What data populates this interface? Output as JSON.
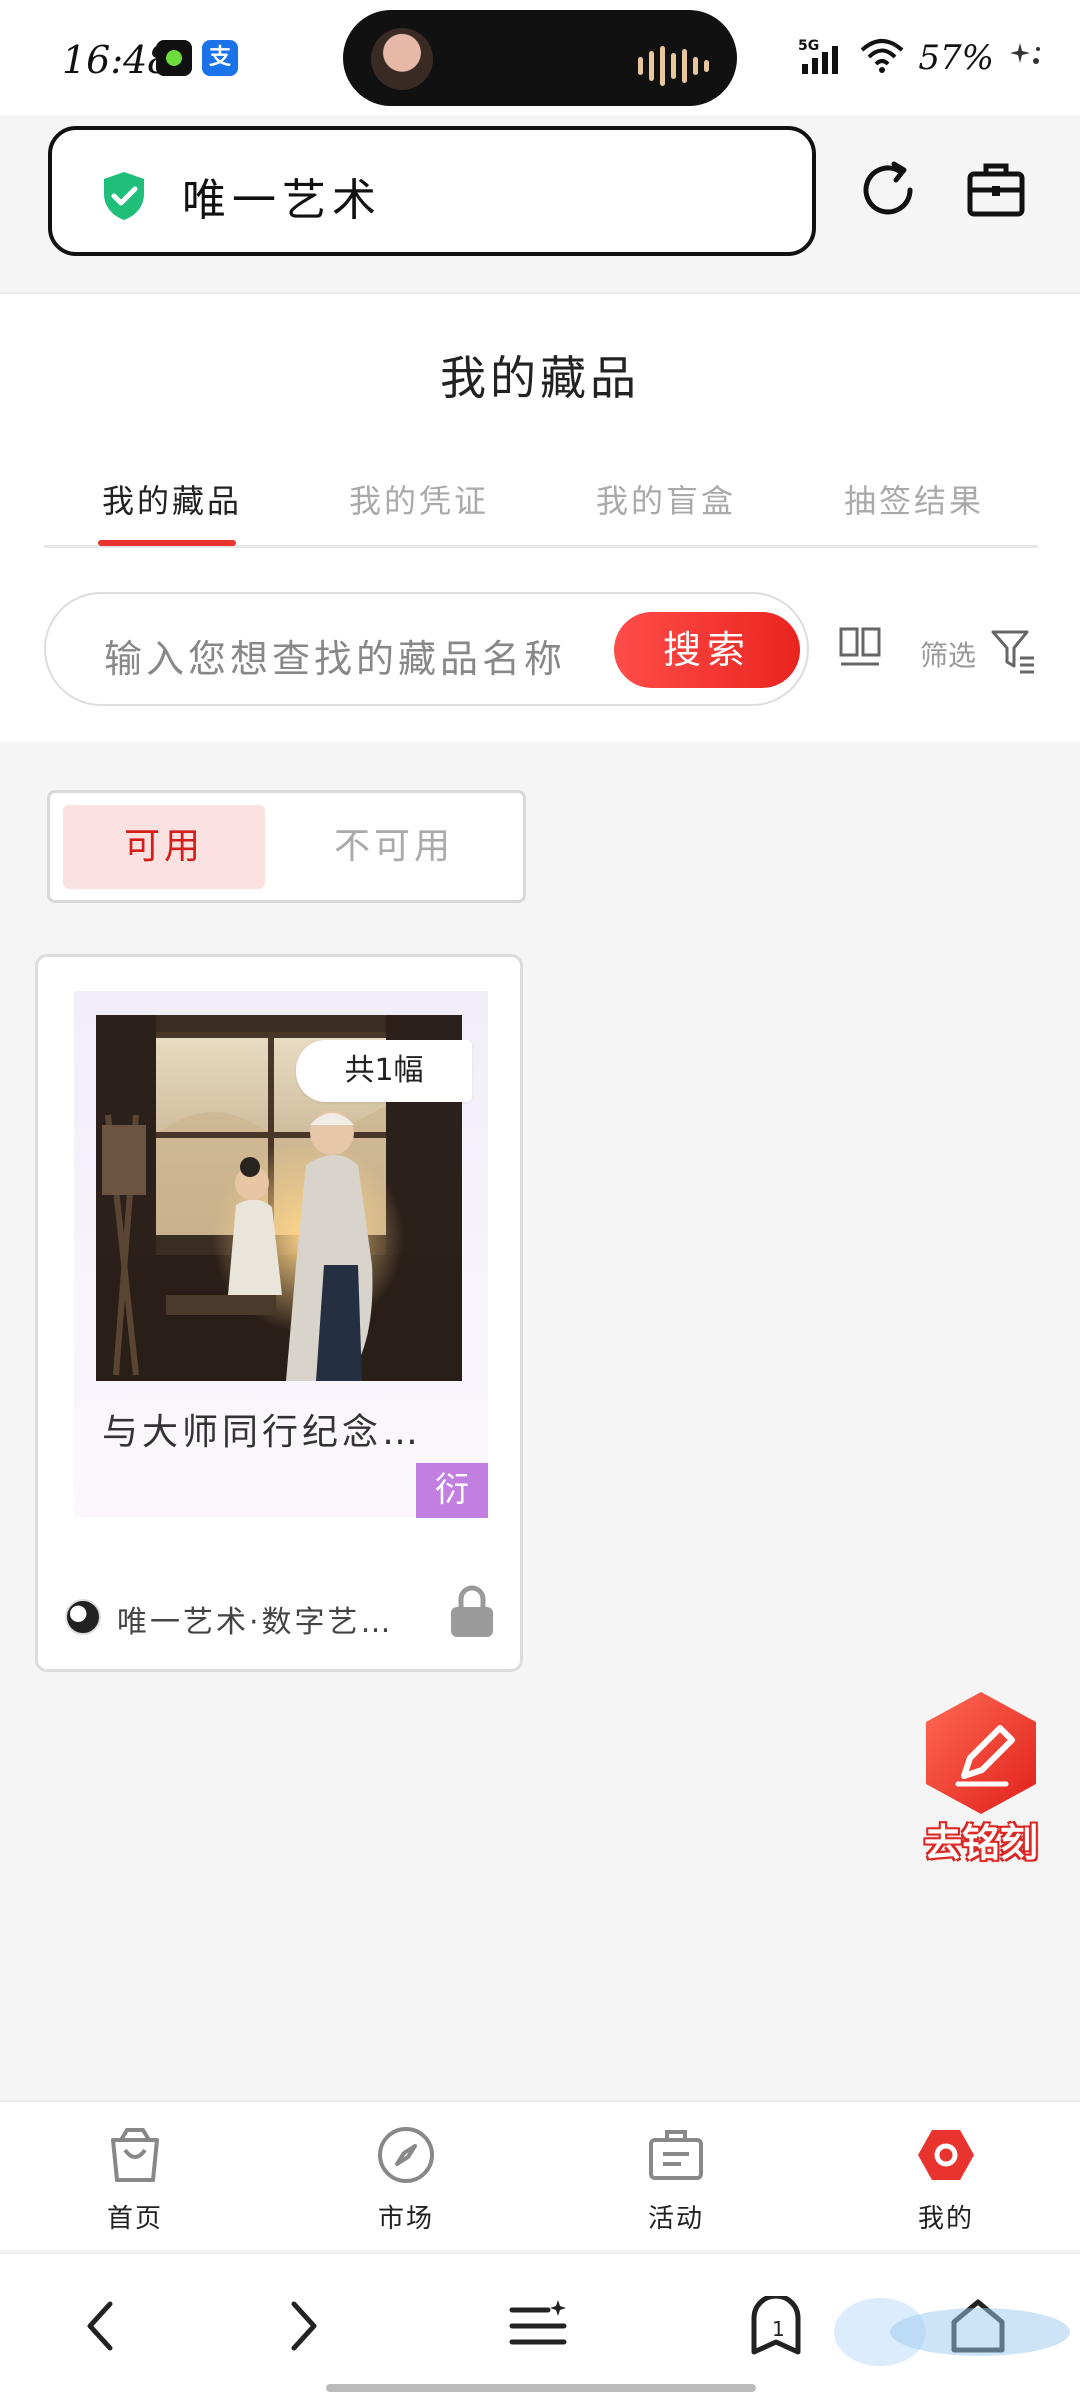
{
  "status_bar": {
    "time": "16:48",
    "network": "5G",
    "battery": "57%"
  },
  "address_bar": {
    "site_name": "唯一艺术"
  },
  "page": {
    "title": "我的藏品"
  },
  "tabs": [
    {
      "label": "我的藏品",
      "active": true
    },
    {
      "label": "我的凭证",
      "active": false
    },
    {
      "label": "我的盲盒",
      "active": false
    },
    {
      "label": "抽签结果",
      "active": false
    }
  ],
  "search": {
    "placeholder": "输入您想查找的藏品名称",
    "button_label": "搜索",
    "filter_label": "筛选"
  },
  "availability": {
    "available_label": "可用",
    "unavailable_label": "不可用"
  },
  "collection_items": [
    {
      "count_label": "共1幅",
      "name": "与大师同行纪念…",
      "type_badge": "衍",
      "publisher": "唯一艺术·数字艺…",
      "locked": true
    }
  ],
  "floating_button": {
    "label": "去铭刻"
  },
  "app_nav": [
    {
      "label": "首页",
      "icon": "shopping-bag-icon"
    },
    {
      "label": "市场",
      "icon": "compass-icon"
    },
    {
      "label": "活动",
      "icon": "briefcase-icon"
    },
    {
      "label": "我的",
      "icon": "hexagon-profile-icon",
      "active": true
    }
  ],
  "browser_bar": {
    "tab_count": "1"
  },
  "colors": {
    "accent": "#e8332f",
    "active_bg": "#fbe2e0",
    "badge_purple": "#c27ee0",
    "shield_green": "#1fbf7a"
  }
}
